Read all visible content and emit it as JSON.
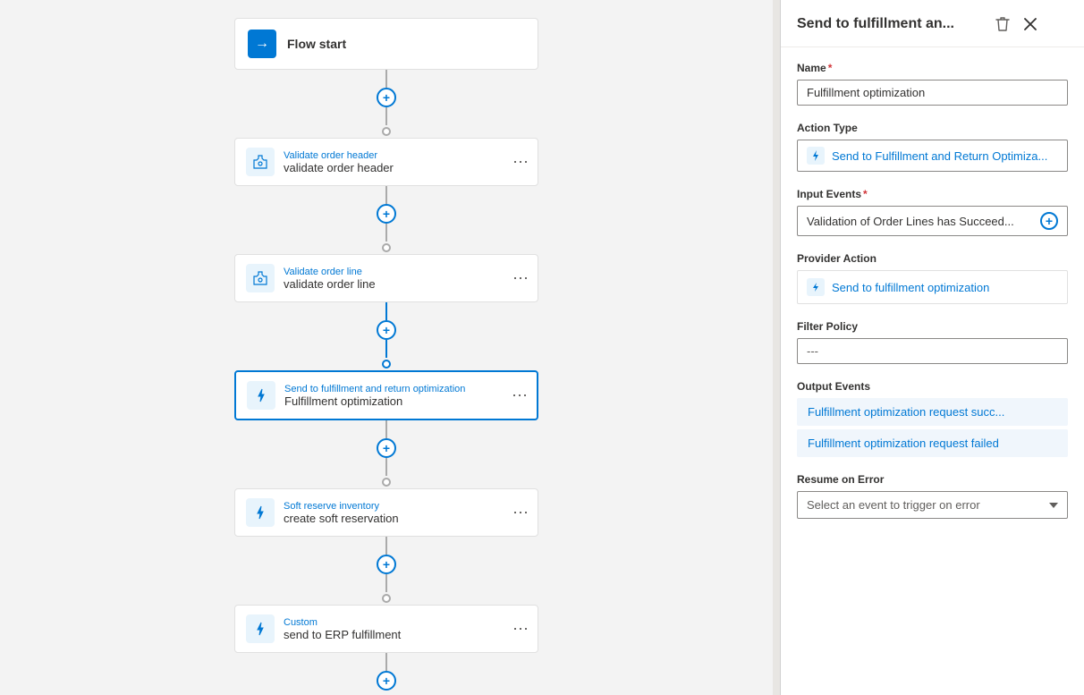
{
  "flowCanvas": {
    "nodes": [
      {
        "id": "flow-start",
        "type": "start",
        "label": "Flow start",
        "icon": "→",
        "iconBg": "blue"
      },
      {
        "id": "validate-header",
        "type": "action",
        "topLabel": "Validate order header",
        "bottomLabel": "validate order header",
        "icon": "🧪",
        "iconBg": "light",
        "selected": false
      },
      {
        "id": "validate-line",
        "type": "action",
        "topLabel": "Validate order line",
        "bottomLabel": "validate order line",
        "icon": "🧪",
        "iconBg": "light",
        "selected": false
      },
      {
        "id": "fulfillment-opt",
        "type": "action",
        "topLabel": "Send to fulfillment and return optimization",
        "bottomLabel": "Fulfillment optimization",
        "icon": "⚡",
        "iconBg": "light",
        "selected": true
      },
      {
        "id": "soft-reserve",
        "type": "action",
        "topLabel": "Soft reserve inventory",
        "bottomLabel": "create soft reservation",
        "icon": "⚡",
        "iconBg": "light",
        "selected": false
      },
      {
        "id": "custom-erp",
        "type": "action",
        "topLabel": "Custom",
        "bottomLabel": "send to ERP fulfillment",
        "icon": "⚡",
        "iconBg": "light",
        "selected": false
      }
    ],
    "connectors": {
      "addLabel": "+",
      "circleColor": "gray"
    }
  },
  "sidePanel": {
    "title": "Send to fulfillment an...",
    "deleteLabel": "🗑",
    "closeLabel": "✕",
    "fields": {
      "name": {
        "label": "Name",
        "required": true,
        "value": "Fulfillment optimization"
      },
      "actionType": {
        "label": "Action Type",
        "value": "Send to Fulfillment and Return Optimiza...",
        "iconText": "⚡"
      },
      "inputEvents": {
        "label": "Input Events",
        "required": true,
        "value": "Validation of Order Lines has Succeed..."
      },
      "providerAction": {
        "label": "Provider Action",
        "value": "Send to fulfillment optimization",
        "iconText": "⚡"
      },
      "filterPolicy": {
        "label": "Filter Policy",
        "value": "---"
      },
      "outputEvents": {
        "label": "Output Events",
        "items": [
          "Fulfillment optimization request succ...",
          "Fulfillment optimization request failed"
        ]
      },
      "resumeOnError": {
        "label": "Resume on Error",
        "placeholder": "Select an event to trigger on error"
      }
    }
  }
}
